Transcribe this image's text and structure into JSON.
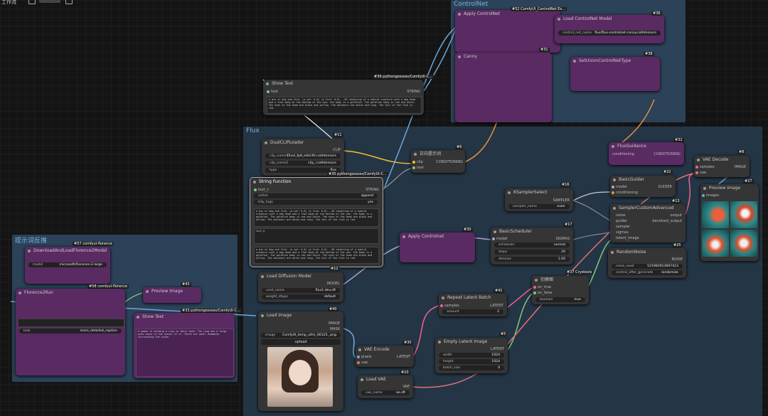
{
  "topbar": {
    "label": "工作流"
  },
  "groups": {
    "controlnet": "ControlNet",
    "flux": "Flux",
    "prompt": "提示词反推"
  },
  "nodes": {
    "showtext": {
      "title": "Show Text",
      "id": "#39 pythongosssss/ComfyUI-C...",
      "in": "text",
      "out": "STRING",
      "content": "a mix of dog and fish, (a cat: 0.8) (a fish: 0.8)...3D rendering of a hybrid creature with a dog head and a fish body.At the bottom of the sea. the body is a goldfish. The goldfish body is red and white. The eyes of the head are black and yellow. The whiskers are white and long. The tail of the fish is red."
    },
    "dualclip": {
      "title": "DualCLIPLoader",
      "id": "#11",
      "out": "CLIP",
      "clip1_l": "clip_name1",
      "clip1_v": "t5xxl_fp8_e4m3fn.safetensors",
      "clip2_l": "clip_name2",
      "clip2_v": "clip_l.safetensors",
      "type_l": "type",
      "type_v": "flux"
    },
    "strfunc": {
      "title": "String Function",
      "id": "#35 pythongosssss/ComfyUI-C...",
      "in": "text_c",
      "out": "STRING",
      "action_l": "action",
      "action_v": "append",
      "tidy_l": "tidy_tags",
      "tidy_v": "yes",
      "text_a": "a mix of dog and fish, (a cat: 0.8) (a fish: 0.8)...3D rendering of a hybrid creature with a dog head and a fish body.At the bottom of the sea. the body is a goldfish. The goldfish body is red and white. The eyes of the head are black and yellow. The whiskers are white and long. The tail of the fish is red.",
      "text_b": "text_b",
      "text_out": "a mix of dog and fish, (a cat: 0.8) (a fish: 0.8)...3D rendering of a hybrid creature with a dog head and a fish body.At the bottom of the sea. the body is a goldfish. The goldfish body is red and white. The eyes of the head are black and yellow. The whiskers are white and long. The tail of the fish is red."
    },
    "encode": {
      "title": "正向提示词",
      "id": "#6",
      "in1": "clip",
      "in2": "text",
      "out": "CONDITIONING"
    },
    "ksampler": {
      "title": "KSamplerSelect",
      "id": "#16",
      "out": "SAMPLER",
      "l": "sampler_name",
      "v": "euler"
    },
    "basicsched": {
      "title": "BasicScheduler",
      "id": "#17",
      "in": "model",
      "out": "SIGMAS",
      "s_l": "scheduler",
      "s_v": "normal",
      "st_l": "steps",
      "st_v": "20",
      "d_l": "denoise",
      "d_v": "1.00"
    },
    "guider": {
      "title": "BasicGuider",
      "id": "#22",
      "in1": "model",
      "in2": "conditioning",
      "out": "GUIDER"
    },
    "sampler": {
      "title": "SamplerCustomAdvanced",
      "id": "#13",
      "ins": [
        "noise",
        "guider",
        "sampler",
        "sigmas",
        "latent_image"
      ],
      "out1": "output",
      "out2": "denoised_output"
    },
    "noise": {
      "title": "RandomNoise",
      "id": "#25",
      "out": "NOISE",
      "seed_l": "noise_seed",
      "seed_v": "521983913697423",
      "ctl_l": "control_after_generate",
      "ctl_v": "randomize"
    },
    "vaedec": {
      "title": "VAE Decode",
      "id": "#8",
      "in1": "samples",
      "in2": "vae",
      "out": "IMAGE"
    },
    "preview": {
      "title": "Preview Image",
      "id": "#27",
      "in": "images"
    },
    "diffusion": {
      "title": "Load Diffusion Model",
      "id": "#12",
      "out": "MODEL",
      "u_l": "unet_name",
      "u_v": "flux1-dev.sft",
      "w_l": "weight_dtype",
      "w_v": "default"
    },
    "loadimg": {
      "title": "Load Image",
      "id": "#40",
      "out1": "IMAGE",
      "out2": "MASK",
      "img_l": "image",
      "img_v": "ComfyUI_temp_uthn_00125_.png",
      "upload": "upload"
    },
    "vaeenc": {
      "title": "VAE Encode",
      "id": "#30",
      "in1": "pixels",
      "in2": "vae",
      "out": "LATENT"
    },
    "loadvae": {
      "title": "Load VAE",
      "id": "#10",
      "out": "VAE",
      "l": "vae_name",
      "v": "ae.sft"
    },
    "repeat": {
      "title": "Repeat Latent Batch",
      "id": "#41",
      "in": "samples",
      "out": "LATENT",
      "l": "amount",
      "v": "2"
    },
    "emptylat": {
      "title": "Empty Latent Image",
      "id": "#5",
      "out": "LATENT",
      "w_l": "width",
      "w_v": "1024",
      "h_l": "height",
      "h_v": "1024",
      "b_l": "batch_size",
      "b_v": "4"
    },
    "switch": {
      "title": "切换图",
      "id": "#37 Crystools",
      "in1": "on_true",
      "in2": "on_false",
      "b_l": "boolean",
      "b_v": "true"
    },
    "fluxguid": {
      "title": "FluxGuidance",
      "id": "#32",
      "in": "conditioning",
      "out": "CONDITIONING"
    },
    "cn_apply": {
      "title": "Apply ControlNet",
      "id": "#52 ComfyUI_ControlNet Ex..."
    },
    "cn_load": {
      "title": "Load ControlNet Model",
      "id": "#36",
      "l": "control_net_name",
      "v": "flux/flux-controlnet-canny.safetensors"
    },
    "cn_union": {
      "title": "Canny",
      "id": "#31"
    },
    "cn_set": {
      "title": "SetUnionControlNetType",
      "id": "#38"
    },
    "cn_lowres": {
      "title": "Apply Controlnet",
      "id": "#30"
    },
    "florence": {
      "title": "DownloadAndLoadFlorence2Model",
      "id": "#57 comfyui-florence",
      "l": "model",
      "v": "microsoft/Florence-2-large"
    },
    "flor_run": {
      "title": "Florence2Run",
      "id": "#58 comfyui-florence"
    },
    "preview_img2": {
      "title": "Preview Image",
      "id": "#43"
    },
    "showtext2": {
      "title": "Show Text",
      "id": "#33 pythongosssss/ComfyUI-C...",
      "content": "A woman is holding a ring to their head. The ring has a large pink stone in the center of it. There are small diamonds surrounding the stone."
    },
    "flor_task": {
      "l": "task",
      "v": "more_detailed_caption"
    }
  },
  "colors": {
    "purple": "#5a2a63",
    "group": "#2b4258",
    "node": "#353535"
  }
}
